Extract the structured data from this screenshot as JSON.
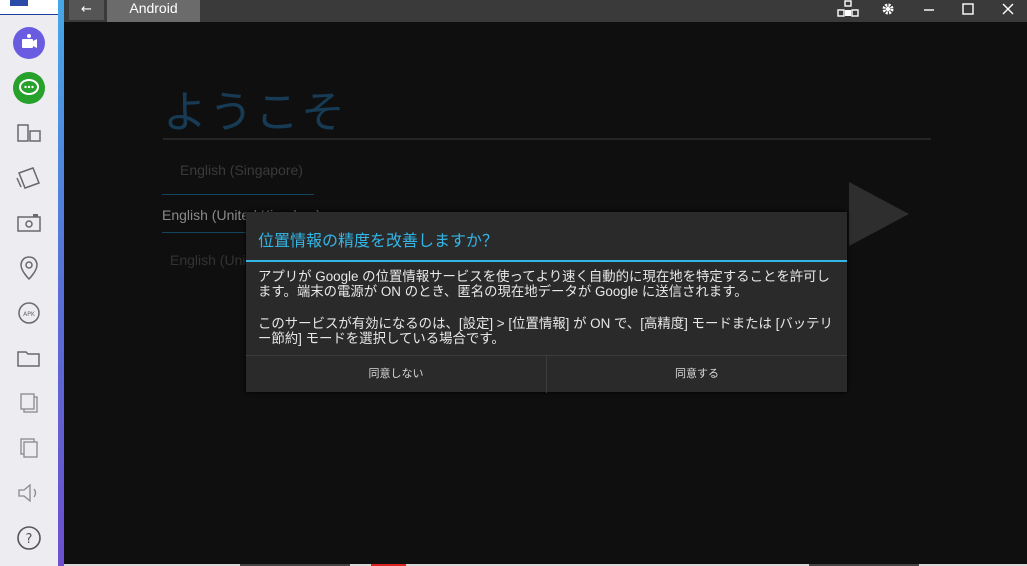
{
  "window": {
    "back_icon": "←",
    "tab_label": "Android"
  },
  "sidebar": {
    "items": [
      {
        "icon": "video-call-icon"
      },
      {
        "icon": "chat-bubble-icon"
      },
      {
        "icon": "rotate-screen-icon"
      },
      {
        "icon": "shake-icon"
      },
      {
        "icon": "camera-icon"
      },
      {
        "icon": "location-pin-icon"
      },
      {
        "icon": "apk-install-icon"
      },
      {
        "icon": "folder-icon"
      },
      {
        "icon": "copy-icon"
      },
      {
        "icon": "paste-icon"
      },
      {
        "icon": "volume-icon"
      },
      {
        "icon": "help-icon"
      }
    ]
  },
  "android": {
    "welcome": "ようこそ",
    "languages": [
      "English (Singapore)",
      "English (United Kingdom)",
      "English (United States)"
    ]
  },
  "dialog": {
    "title": "位置情報の精度を改善しますか？",
    "body1": "アプリが Google の位置情報サービスを使ってより速く自動的に現在地を特定することを許可します。端末の電源が ON のとき、匿名の現在地データが Google に送信されます。",
    "body2": "このサービスが有効になるのは、[設定] > [位置情報] が ON で、[高精度] モードまたは [バッテリー節約] モードを選択している場合です。",
    "decline": "同意しない",
    "accept": "同意する"
  }
}
